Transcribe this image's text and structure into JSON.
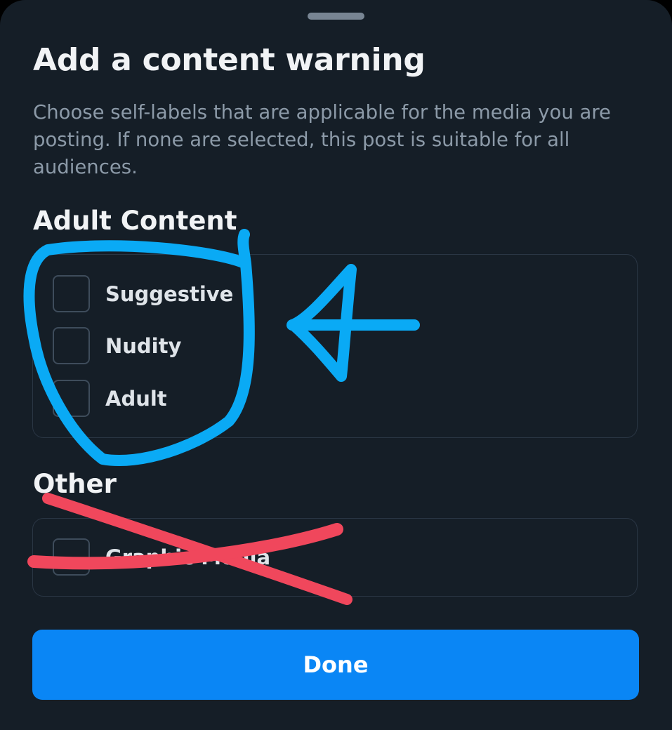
{
  "sheet": {
    "title": "Add a content warning",
    "description": "Choose self-labels that are applicable for the media you are posting. If none are selected, this post is suitable for all audiences."
  },
  "sections": {
    "adult": {
      "heading": "Adult Content",
      "options": [
        {
          "label": "Suggestive",
          "checked": false
        },
        {
          "label": "Nudity",
          "checked": false
        },
        {
          "label": "Adult",
          "checked": false
        }
      ]
    },
    "other": {
      "heading": "Other",
      "options": [
        {
          "label": "Graphic Media",
          "checked": false
        }
      ]
    }
  },
  "footer": {
    "done_label": "Done"
  },
  "annotations": {
    "circle_color": "#0aaaf5",
    "arrow_color": "#0aaaf5",
    "cross_color": "#f0475c"
  },
  "colors": {
    "background": "#151e27",
    "accent": "#0a86f5",
    "text_primary": "#f1f3f5",
    "text_secondary": "#8c9aa8"
  }
}
